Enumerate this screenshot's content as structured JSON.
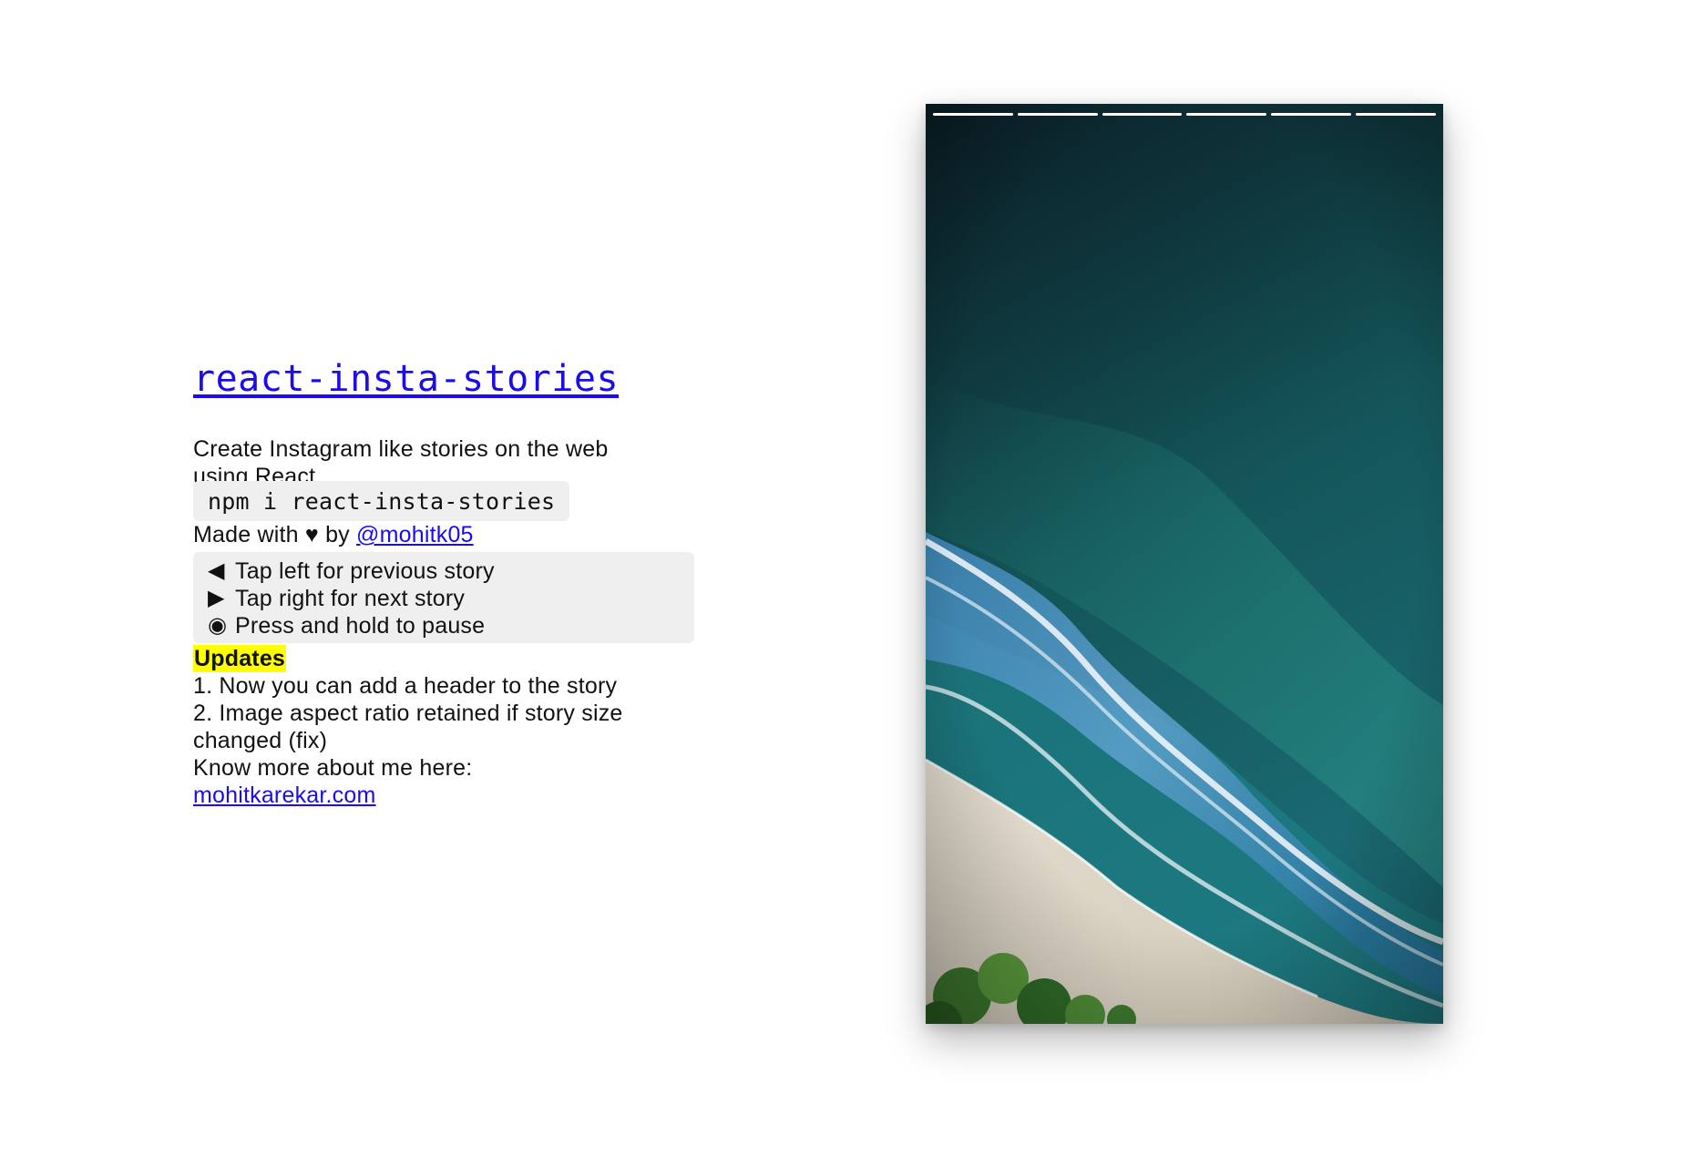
{
  "info": {
    "title": "react-insta-stories",
    "description": "Create Instagram like stories on the web using React",
    "npm_command": "npm i react-insta-stories",
    "made_with_prefix": "Made with ♥ by ",
    "author_link": "@mohitk05",
    "instructions": [
      {
        "glyph": "◀",
        "icon": "triangle-left-icon",
        "text": "Tap left for previous story"
      },
      {
        "glyph": "▶",
        "icon": "triangle-right-icon",
        "text": "Tap right for next story"
      },
      {
        "glyph": "◉",
        "icon": "record-circle-icon",
        "text": "Press and hold to pause"
      }
    ],
    "updates_label": "Updates",
    "updates": [
      "1. Now you can add a header to the story",
      "2. Image aspect ratio retained if story size changed (fix)"
    ],
    "know_more": "Know more about me here:",
    "website_link": "mohitkarekar.com"
  },
  "story": {
    "progress": [
      1,
      1,
      1,
      1,
      1,
      1
    ],
    "image": "aerial-beach-ocean-photo"
  },
  "colors": {
    "link": "#1a0dea",
    "highlight": "#ffff00",
    "code_bg": "#efefef"
  }
}
